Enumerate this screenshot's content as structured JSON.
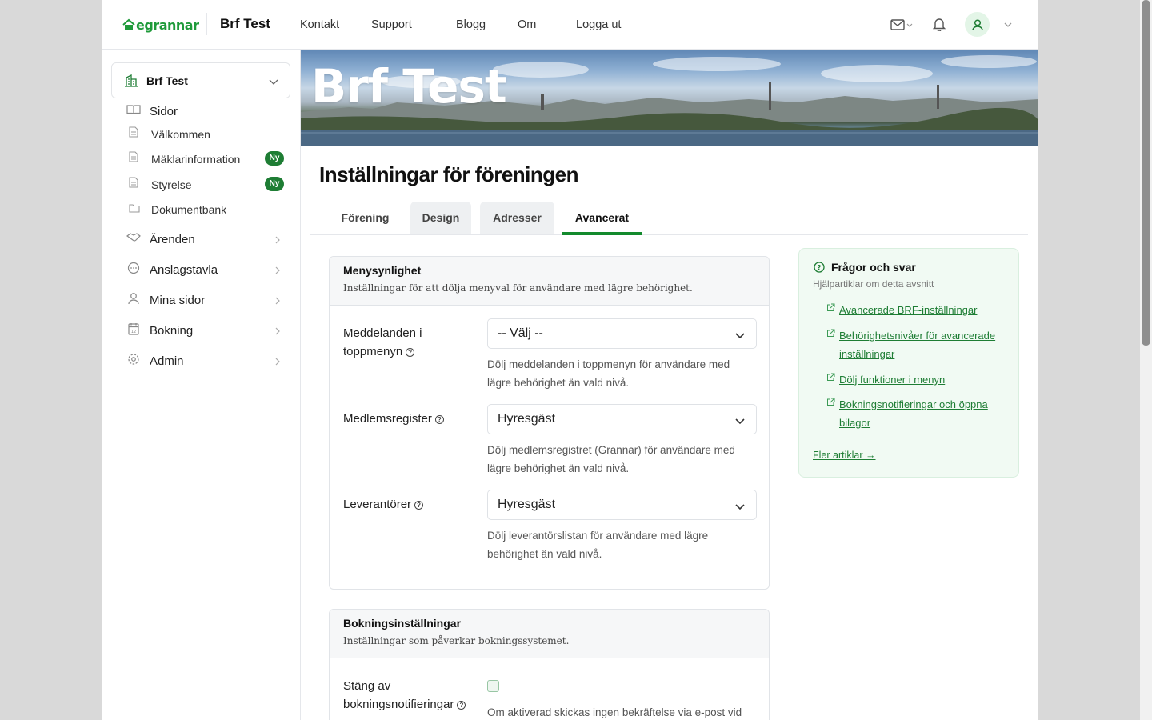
{
  "header": {
    "logo_text": "egrannar",
    "brand": "Brf Test",
    "nav": [
      "Kontakt",
      "Support",
      "Blogg",
      "Om",
      "Logga ut"
    ]
  },
  "sidebar": {
    "org_name": "Brf Test",
    "sections": {
      "sidor": "Sidor",
      "pages": [
        {
          "label": "Välkommen",
          "badge": ""
        },
        {
          "label": "Mäklarinformation",
          "badge": "Ny"
        },
        {
          "label": "Styrelse",
          "badge": "Ny"
        },
        {
          "label": "Dokumentbank",
          "badge": ""
        }
      ],
      "items": [
        "Ärenden",
        "Anslagstavla",
        "Mina sidor",
        "Bokning",
        "Admin"
      ]
    }
  },
  "banner": {
    "title": "Brf Test"
  },
  "main": {
    "title": "Inställningar för föreningen",
    "tabs": [
      "Förening",
      "Design",
      "Adresser",
      "Avancerat"
    ],
    "active_tab": "Avancerat",
    "menu_card": {
      "title": "Menysynlighet",
      "subtitle": "Inställningar för att dölja menyval för användare med lägre behörighet.",
      "fields": [
        {
          "label_line1": "Meddelanden i",
          "label_line2": "toppmenyn",
          "value": "-- Välj --",
          "help": "Dölj meddelanden i toppmenyn för användare med lägre behörighet än vald nivå."
        },
        {
          "label_line1": "Medlemsregister",
          "label_line2": "",
          "value": "Hyresgäst",
          "help": "Dölj medlemsregistret (Grannar) för användare med lägre behörighet än vald nivå."
        },
        {
          "label_line1": "Leverantörer",
          "label_line2": "",
          "value": "Hyresgäst",
          "help": "Dölj leverantörslistan för användare med lägre behörighet än vald nivå."
        }
      ]
    },
    "booking_card": {
      "title": "Bokningsinställningar",
      "subtitle": "Inställningar som påverkar bokningssystemet.",
      "field_line1": "Stäng av",
      "field_line2": "bokningsnotifieringar",
      "help": "Om aktiverad skickas ingen bekräftelse via e-post vid",
      "checked": false
    }
  },
  "faq": {
    "title": "Frågor och svar",
    "subtitle": "Hjälpartiklar om detta avsnitt",
    "links": [
      "Avancerade BRF-inställningar",
      "Behörighetsnivåer för avancerade inställningar",
      "Dölj funktioner i menyn",
      "Bokningsnotifieringar och öppna bilagor"
    ],
    "more": "Fler artiklar"
  },
  "colors": {
    "accent": "#138a2d",
    "badge": "#1e7d34",
    "faq_bg": "#f1faf3"
  }
}
